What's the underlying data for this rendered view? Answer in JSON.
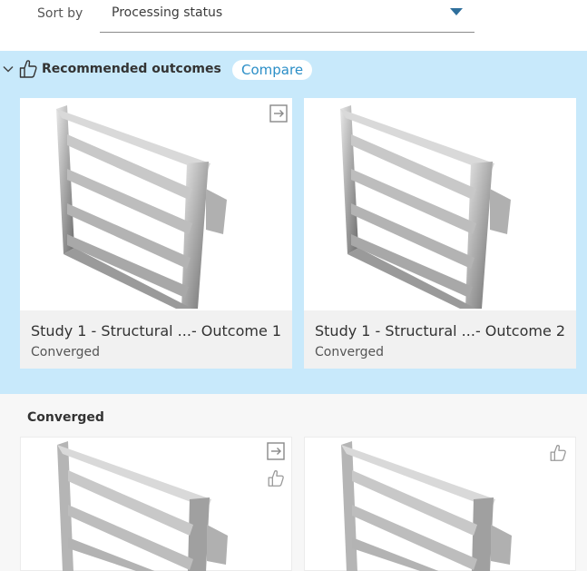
{
  "sort": {
    "label": "Sort by",
    "value": "Processing status"
  },
  "recommended": {
    "title": "Recommended outcomes",
    "compare_label": "Compare",
    "cards": [
      {
        "name": "Study 1 - Structural ...- Outcome 1",
        "status": "Converged"
      },
      {
        "name": "Study 1 - Structural ...- Outcome 2",
        "status": "Converged"
      }
    ]
  },
  "converged": {
    "title": "Converged"
  },
  "colors": {
    "recommended_bg": "#c8e9fb",
    "accent": "#2b8ec7"
  }
}
